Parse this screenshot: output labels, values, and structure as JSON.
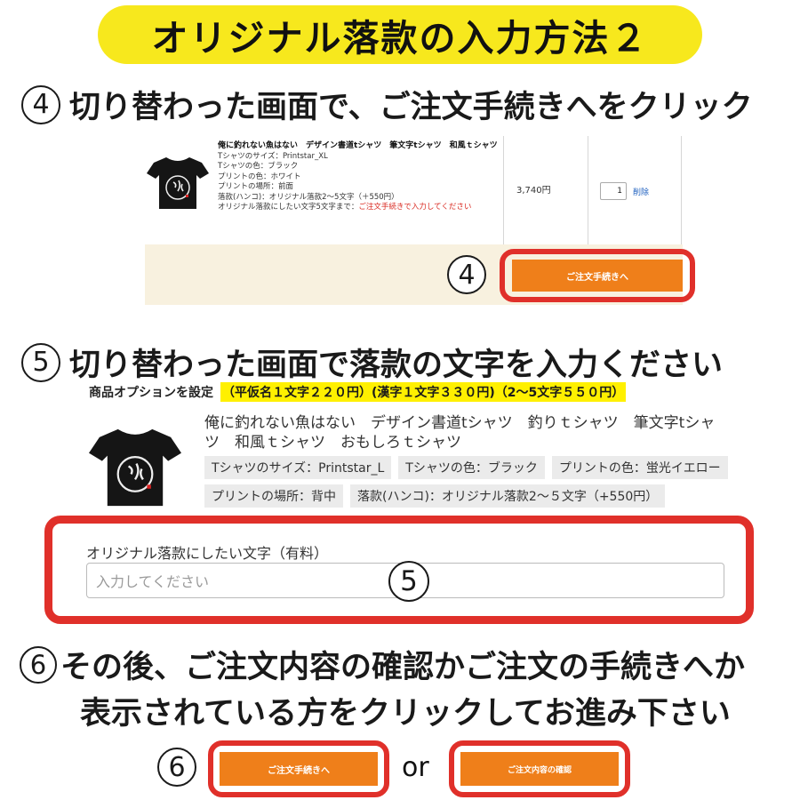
{
  "title": "オリジナル落款の入力方法２",
  "step4": {
    "number": "④",
    "heading": "切り替わった画面で、ご注文手続きへをクリック",
    "product_name": "俺に釣れない魚はない　デザイン書道tシャツ　筆文字tシャツ　和風ｔシャツ",
    "options": [
      "Tシャツのサイズ：Printstar_XL",
      "Tシャツの色：ブラック",
      "プリントの色：ホワイト",
      "プリントの場所：前面",
      "落款(ハンコ)：オリジナル落款2～5文字（＋550円）"
    ],
    "rakkan_text_label": "オリジナル落款にしたい文字5文字まで：",
    "rakkan_text_value": "ご注文手続きで入力してください",
    "price": "3,740円",
    "quantity": "1",
    "delete_label": "削除",
    "marker": "④",
    "checkout_button": "ご注文手続きへ"
  },
  "step5": {
    "number": "⑤",
    "heading": "切り替わった画面で落款の文字を入力ください",
    "section_label": "商品オプションを設定",
    "price_note": "（平仮名１文字２２０円）(漢字１文字３３０円)（2～5文字５５０円）",
    "product_name": "俺に釣れない魚はない　デザイン書道tシャツ　釣りｔシャツ　筆文字tシャツ　和風ｔシャツ　おもしろｔシャツ",
    "option_tags": [
      "Tシャツのサイズ：Printstar_L",
      "Tシャツの色：ブラック",
      "プリントの色：蛍光イエロー",
      "プリントの場所：背中",
      "落款(ハンコ)：オリジナル落款2～５文字（+550円）"
    ],
    "field_label": "オリジナル落款にしたい文字（有料）",
    "field_placeholder": "入力してください",
    "marker": "⑤"
  },
  "step6": {
    "number": "⑥",
    "heading_line1": "その後、ご注文内容の確認かご注文の手続きへか",
    "heading_line2": "表示されている方をクリックしてお進み下さい",
    "marker": "⑥",
    "button_checkout": "ご注文手続きへ",
    "or_label": "or",
    "button_confirm": "ご注文内容の確認"
  },
  "colors": {
    "title_bg": "#f7e81d",
    "orange": "#ef7f1a",
    "red_frame": "#e0302a",
    "cart_footer_bg": "#f8f1df",
    "highlight": "#fff000"
  },
  "icons": [
    "tshirt-icon"
  ]
}
